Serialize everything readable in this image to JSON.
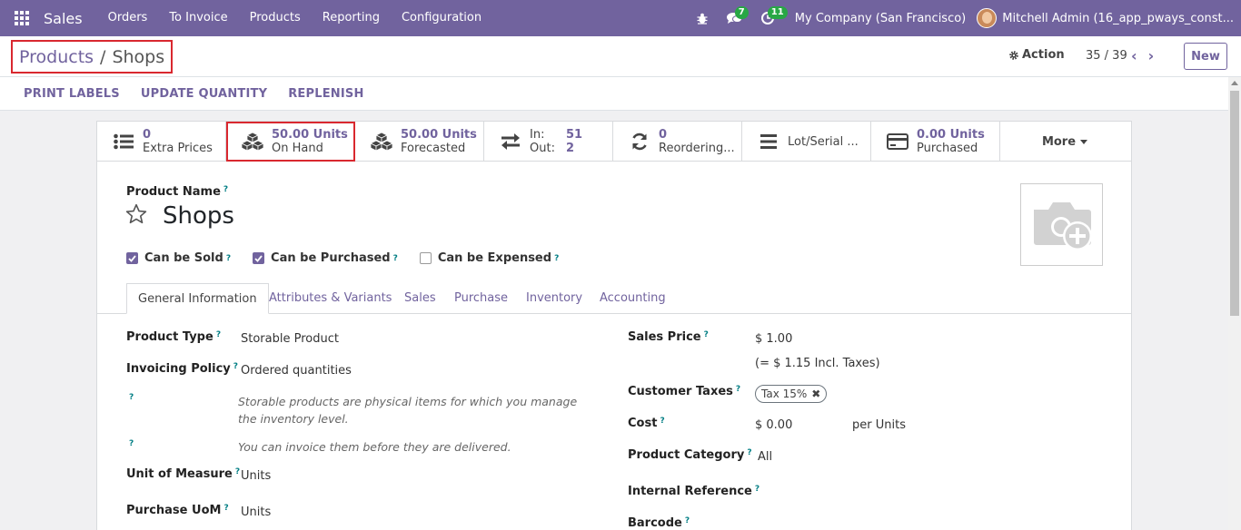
{
  "navbar": {
    "app_name": "Sales",
    "menu": [
      "Orders",
      "To Invoice",
      "Products",
      "Reporting",
      "Configuration"
    ],
    "chat_badge": "7",
    "activity_badge": "11",
    "company": "My Company (San Francisco)",
    "user": "Mitchell Admin (16_app_pways_const..."
  },
  "control_panel": {
    "breadcrumb_parent": "Products",
    "breadcrumb_sep": "/",
    "breadcrumb_current": "Shops",
    "action_label": "Action",
    "pager": "35 / 39",
    "new_label": "New"
  },
  "action_bar": {
    "buttons": [
      "PRINT LABELS",
      "UPDATE QUANTITY",
      "REPLENISH"
    ]
  },
  "smart_buttons": {
    "extra_prices": {
      "value": "0",
      "label": "Extra Prices"
    },
    "on_hand": {
      "value": "50.00 Units",
      "label": "On Hand"
    },
    "forecasted": {
      "value": "50.00 Units",
      "label": "Forecasted"
    },
    "in_out": {
      "in_label": "In:",
      "in_value": "51",
      "out_label": "Out:",
      "out_value": "2"
    },
    "reordering": {
      "value": "0",
      "label": "Reordering..."
    },
    "lot_serial": {
      "label": "Lot/Serial ..."
    },
    "purchased": {
      "value": "0.00 Units",
      "label": "Purchased"
    },
    "more": "More"
  },
  "product": {
    "name_label": "Product Name",
    "name": "Shops",
    "help_mark": "?",
    "checkboxes": [
      {
        "label": "Can be Sold",
        "checked": true
      },
      {
        "label": "Can be Purchased",
        "checked": true
      },
      {
        "label": "Can be Expensed",
        "checked": false
      }
    ]
  },
  "tabs": [
    "General Information",
    "Attributes & Variants",
    "Sales",
    "Purchase",
    "Inventory",
    "Accounting"
  ],
  "general": {
    "product_type_label": "Product Type",
    "product_type": "Storable Product",
    "invoicing_policy_label": "Invoicing Policy",
    "invoicing_policy": "Ordered quantities",
    "help_storable": "Storable products are physical items for which you manage the inventory level.",
    "help_invoice": "You can invoice them before they are delivered.",
    "uom_label": "Unit of Measure",
    "uom": "Units",
    "purchase_uom_label": "Purchase UoM",
    "purchase_uom": "Units",
    "sales_price_label": "Sales Price",
    "sales_price": "$ 1.00",
    "sales_price_incl": "(= $ 1.15 Incl. Taxes)",
    "customer_taxes_label": "Customer Taxes",
    "customer_tax_tag": "Tax 15%",
    "cost_label": "Cost",
    "cost": "$ 0.00",
    "cost_unit": "per Units",
    "category_label": "Product Category",
    "category": "All",
    "internal_ref_label": "Internal Reference",
    "barcode_label": "Barcode"
  },
  "colors": {
    "brand": "#71639e",
    "highlight": "#d9282f",
    "badge": "#28a745"
  }
}
